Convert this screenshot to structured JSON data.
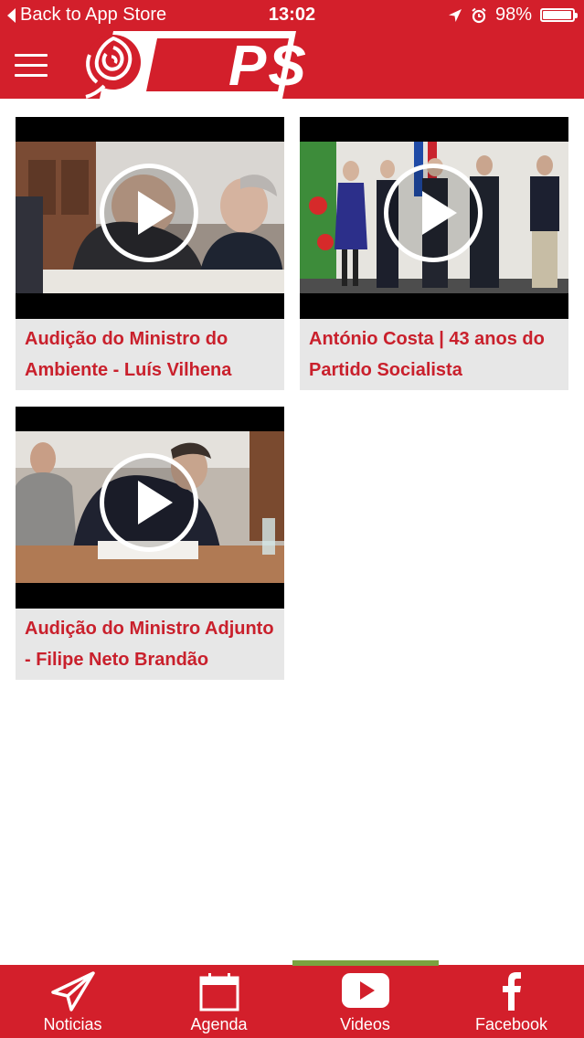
{
  "status_bar": {
    "back_label": "Back to App Store",
    "time": "13:02",
    "battery": "98%",
    "battery_level": 0.98
  },
  "header": {
    "logo_text": "PS",
    "menu_icon": "hamburger-menu-icon"
  },
  "videos": [
    {
      "title": "Audição do Ministro do Ambiente - Luís Vilhena",
      "play_icon": "play-icon"
    },
    {
      "title": "António Costa | 43 anos do Partido Socialista",
      "play_icon": "play-icon"
    },
    {
      "title": "Audição do Ministro Adjunto - Filipe Neto Brandão",
      "play_icon": "play-icon"
    }
  ],
  "tab_bar": {
    "active_tab": "Videos",
    "tabs": [
      {
        "label": "Noticias",
        "icon": "paper-plane-icon"
      },
      {
        "label": "Agenda",
        "icon": "calendar-icon"
      },
      {
        "label": "Videos",
        "icon": "youtube-play-icon"
      },
      {
        "label": "Facebook",
        "icon": "facebook-icon"
      }
    ]
  },
  "colors": {
    "brand_red": "#d31f2b",
    "title_red": "#c9202c",
    "active_indicator": "#7aa33f",
    "card_background": "#e7e7e7"
  }
}
